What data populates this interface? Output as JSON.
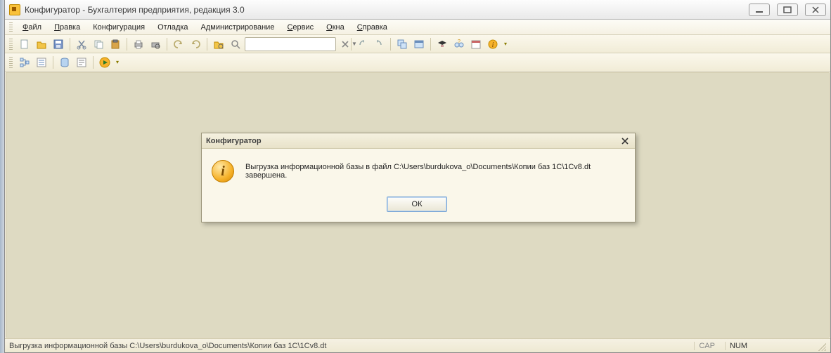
{
  "window": {
    "title": "Конфигуратор - Бухгалтерия предприятия, редакция 3.0"
  },
  "menu": {
    "file": "Файл",
    "edit": "Правка",
    "config": "Конфигурация",
    "debug": "Отладка",
    "admin": "Администрирование",
    "service": "Сервис",
    "windows_m": "Окна",
    "help": "Справка"
  },
  "search": {
    "value": ""
  },
  "dialog": {
    "title": "Конфигуратор",
    "message": "Выгрузка информационной базы в файл C:\\Users\\burdukova_o\\Documents\\Копии баз 1С\\1Cv8.dt завершена.",
    "ok": "ОК"
  },
  "status": {
    "text": "Выгрузка информационной базы C:\\Users\\burdukova_o\\Documents\\Копии баз 1С\\1Cv8.dt",
    "cap": "CAP",
    "num": "NUM"
  }
}
